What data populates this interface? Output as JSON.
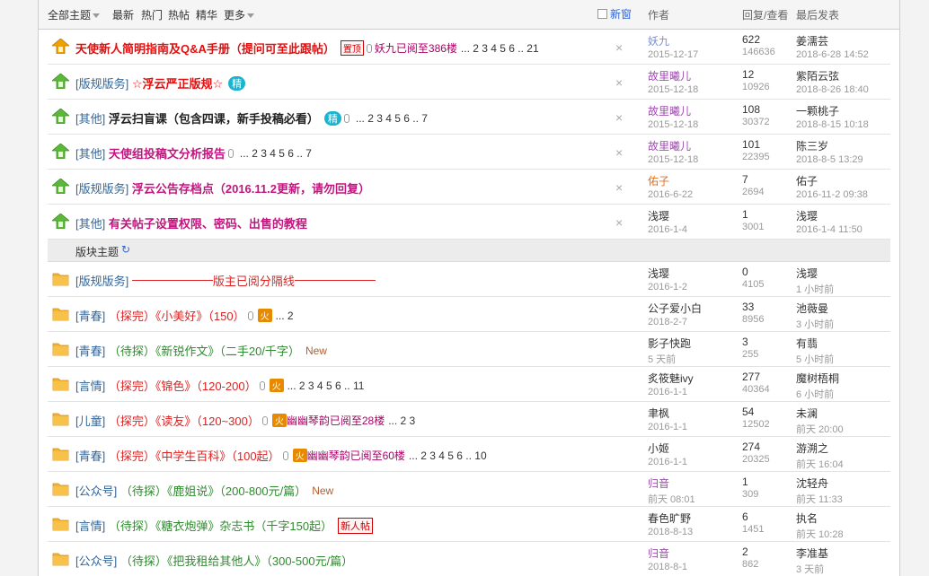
{
  "header": {
    "all_topics": "全部主题",
    "latest": "最新",
    "hot": "热门",
    "hot_posts": "热帖",
    "digest": "精华",
    "more": "更多",
    "new_window": "新窗",
    "col_author": "作者",
    "col_replies": "回复/查看",
    "col_last": "最后发表"
  },
  "sticky": [
    {
      "cat": "",
      "title": "天使新人简明指南及Q&A手册（提问可至此跟帖）",
      "style": "red",
      "badge": "置顶",
      "extra": "妖九已阅至386楼",
      "pages": "... 2  3  4  5  6 .. 21",
      "author": "妖九",
      "author_color": "#7a8ed6",
      "date": "2015-12-17",
      "replies": "622",
      "views": "146636",
      "last_user": "姜濡芸",
      "last_time": "2018-6-28 14:52"
    },
    {
      "cat": "[版规版务]",
      "title": "☆浮云严正版规☆",
      "style": "red",
      "badge": "精",
      "extra": "",
      "pages": "",
      "author": "故里曦儿",
      "author_color": "#a04cb0",
      "date": "2015-12-18",
      "replies": "12",
      "views": "10926",
      "last_user": "紫陌云弦",
      "last_time": "2018-8-26 18:40"
    },
    {
      "cat": "[其他]",
      "title": "浮云扫盲课（包含四课，新手投稿必看）",
      "style": "black",
      "badge": "精",
      "extra": "",
      "pages": "... 2  3  4  5  6 .. 7",
      "author": "故里曦儿",
      "author_color": "#a04cb0",
      "date": "2015-12-18",
      "replies": "108",
      "views": "30372",
      "last_user": "一颗桃子",
      "last_time": "2018-8-15 10:18"
    },
    {
      "cat": "[其他]",
      "title": "天使组投稿文分析报告",
      "style": "mag",
      "badge": "",
      "extra": "",
      "pages": "... 2  3  4  5  6 .. 7",
      "author": "故里曦儿",
      "author_color": "#a04cb0",
      "date": "2015-12-18",
      "replies": "101",
      "views": "22395",
      "last_user": "陈三岁",
      "last_time": "2018-8-5 13:29"
    },
    {
      "cat": "[版规版务]",
      "title": "浮云公告存档点（2016.11.2更新，请勿回复）",
      "style": "mag",
      "badge": "",
      "extra": "",
      "pages": "",
      "author": "佑子",
      "author_color": "#e07020",
      "date": "2016-6-22",
      "replies": "7",
      "views": "2694",
      "last_user": "佑子",
      "last_time": "2016-11-2 09:38"
    },
    {
      "cat": "[其他]",
      "title": "有关帖子设置权限、密码、出售的教程",
      "style": "mag",
      "badge": "",
      "extra": "",
      "pages": "",
      "author": "浅璎",
      "author_color": "#333333",
      "date": "2016-1-4",
      "replies": "1",
      "views": "3001",
      "last_user": "浅璎",
      "last_time": "2016-1-4 11:50"
    }
  ],
  "section_label": "版块主题",
  "threads": [
    {
      "cat": "[版规版务]",
      "title": "版主已阅分隔线",
      "style": "divider",
      "badge": "",
      "extra": "",
      "pages": "",
      "newtag": "",
      "author": "浅璎",
      "author_color": "#333333",
      "date": "2016-1-2",
      "replies": "0",
      "views": "4105",
      "last_user": "浅璎",
      "last_time": "1 小时前"
    },
    {
      "cat": "[青春]",
      "title": "（探完）《小美好》（150）",
      "style": "plainred",
      "badge": "火",
      "extra": "",
      "pages": "... 2",
      "newtag": "",
      "author": "公子爱小白",
      "author_color": "#333333",
      "date": "2018-2-7",
      "replies": "33",
      "views": "8956",
      "last_user": "池薇曼",
      "last_time": "3 小时前"
    },
    {
      "cat": "[青春]",
      "title": "（待探）《新锐作文》（二手20/千字）",
      "style": "green",
      "badge": "",
      "extra": "",
      "pages": "",
      "newtag": "New",
      "author": "影子快跑",
      "author_color": "#333333",
      "date": "5 天前",
      "replies": "3",
      "views": "255",
      "last_user": "有翡",
      "last_time": "5 小时前"
    },
    {
      "cat": "[言情]",
      "title": "（探完）《锦色》（120-200）",
      "style": "plainred",
      "badge": "火",
      "extra": "",
      "pages": "... 2  3  4  5  6 .. 11",
      "newtag": "",
      "author": "炙筱魅ivy",
      "author_color": "#333333",
      "date": "2016-1-1",
      "replies": "277",
      "views": "40364",
      "last_user": "魔树梧桐",
      "last_time": "6 小时前"
    },
    {
      "cat": "[儿童]",
      "title": "（探完）《读友》（120~300）",
      "style": "plainred",
      "badge": "火",
      "extra": "幽幽琴韵已阅至28楼",
      "pages": "... 2  3",
      "newtag": "",
      "author": "聿枫",
      "author_color": "#333333",
      "date": "2016-1-1",
      "replies": "54",
      "views": "12502",
      "last_user": "未澜",
      "last_time": "前天 20:00"
    },
    {
      "cat": "[青春]",
      "title": "（探完）《中学生百科》（100起）",
      "style": "plainred",
      "badge": "火",
      "extra": "幽幽琴韵已阅至60楼",
      "pages": "... 2  3  4  5  6 .. 10",
      "newtag": "",
      "author": "小姬",
      "author_color": "#333333",
      "date": "2016-1-1",
      "replies": "274",
      "views": "20325",
      "last_user": "游溯之",
      "last_time": "前天 16:04"
    },
    {
      "cat": "[公众号]",
      "title": "（待探）《鹿姐说》（200-800元/篇）",
      "style": "green",
      "badge": "",
      "extra": "",
      "pages": "",
      "newtag": "New",
      "author": "归音",
      "author_color": "#a04cb0",
      "date": "前天 08:01",
      "replies": "1",
      "views": "309",
      "last_user": "沈轻舟",
      "last_time": "前天 11:33"
    },
    {
      "cat": "[言情]",
      "title": "（待探）《糖衣炮弹》杂志书（千字150起）",
      "style": "green",
      "badge": "新人帖",
      "extra": "",
      "pages": "",
      "newtag": "",
      "author": "春色旷野",
      "author_color": "#333333",
      "date": "2018-8-13",
      "replies": "6",
      "views": "1451",
      "last_user": "执名",
      "last_time": "前天 10:28"
    },
    {
      "cat": "[公众号]",
      "title": "（待探）《把我租给其他人》（300-500元/篇）",
      "style": "green",
      "badge": "",
      "extra": "",
      "pages": "",
      "newtag": "",
      "author": "归音",
      "author_color": "#a04cb0",
      "date": "2018-8-1",
      "replies": "2",
      "views": "862",
      "last_user": "李准基",
      "last_time": "3 天前"
    }
  ],
  "colors": {
    "accent": "#336699",
    "sticky_red": "#e01010",
    "magenta": "#c2157e",
    "green": "#2e8b2e"
  }
}
